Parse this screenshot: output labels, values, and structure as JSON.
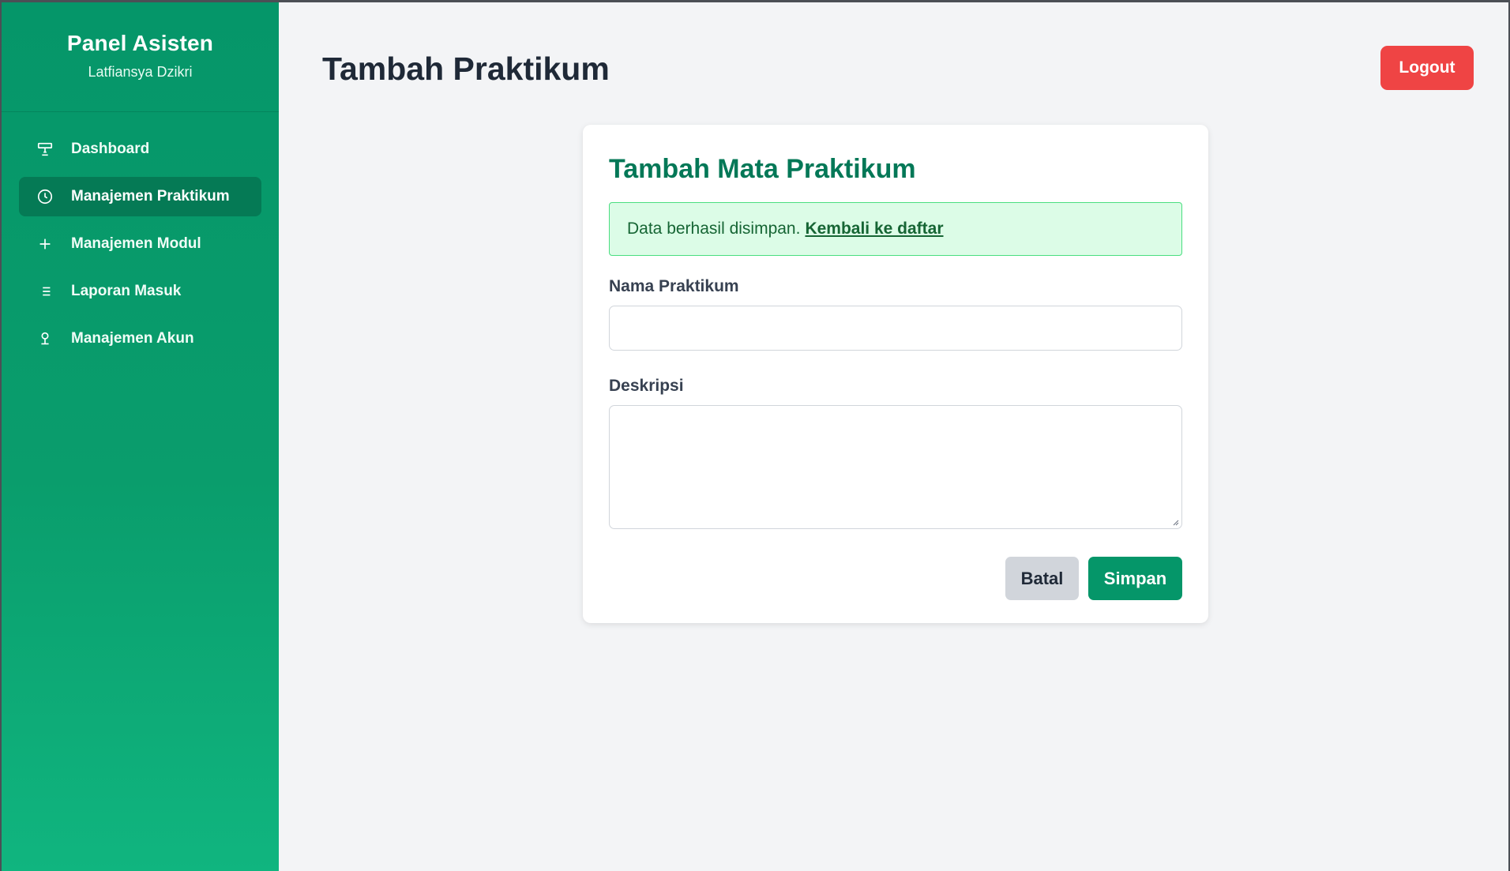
{
  "sidebar": {
    "title": "Panel Asisten",
    "user": "Latfiansya Dzikri",
    "items": [
      {
        "label": "Dashboard",
        "icon": "monitor-icon",
        "active": false
      },
      {
        "label": "Manajemen Praktikum",
        "icon": "clock-icon",
        "active": true
      },
      {
        "label": "Manajemen Modul",
        "icon": "plus-icon",
        "active": false
      },
      {
        "label": "Laporan Masuk",
        "icon": "list-icon",
        "active": false
      },
      {
        "label": "Manajemen Akun",
        "icon": "user-icon",
        "active": false
      }
    ]
  },
  "header": {
    "title": "Tambah Praktikum",
    "logout_label": "Logout"
  },
  "form": {
    "title": "Tambah Mata Praktikum",
    "alert_text": "Data berhasil disimpan.",
    "alert_link": "Kembali ke daftar",
    "name_label": "Nama Praktikum",
    "name_value": "",
    "description_label": "Deskripsi",
    "description_value": "",
    "cancel_label": "Batal",
    "save_label": "Simpan"
  },
  "colors": {
    "sidebar_green": "#059669",
    "active_item": "#057a55",
    "logout_red": "#ef4444",
    "title_green": "#047857",
    "alert_bg": "#dcfce7",
    "alert_border": "#4ade80",
    "cancel_gray": "#d1d5db"
  }
}
